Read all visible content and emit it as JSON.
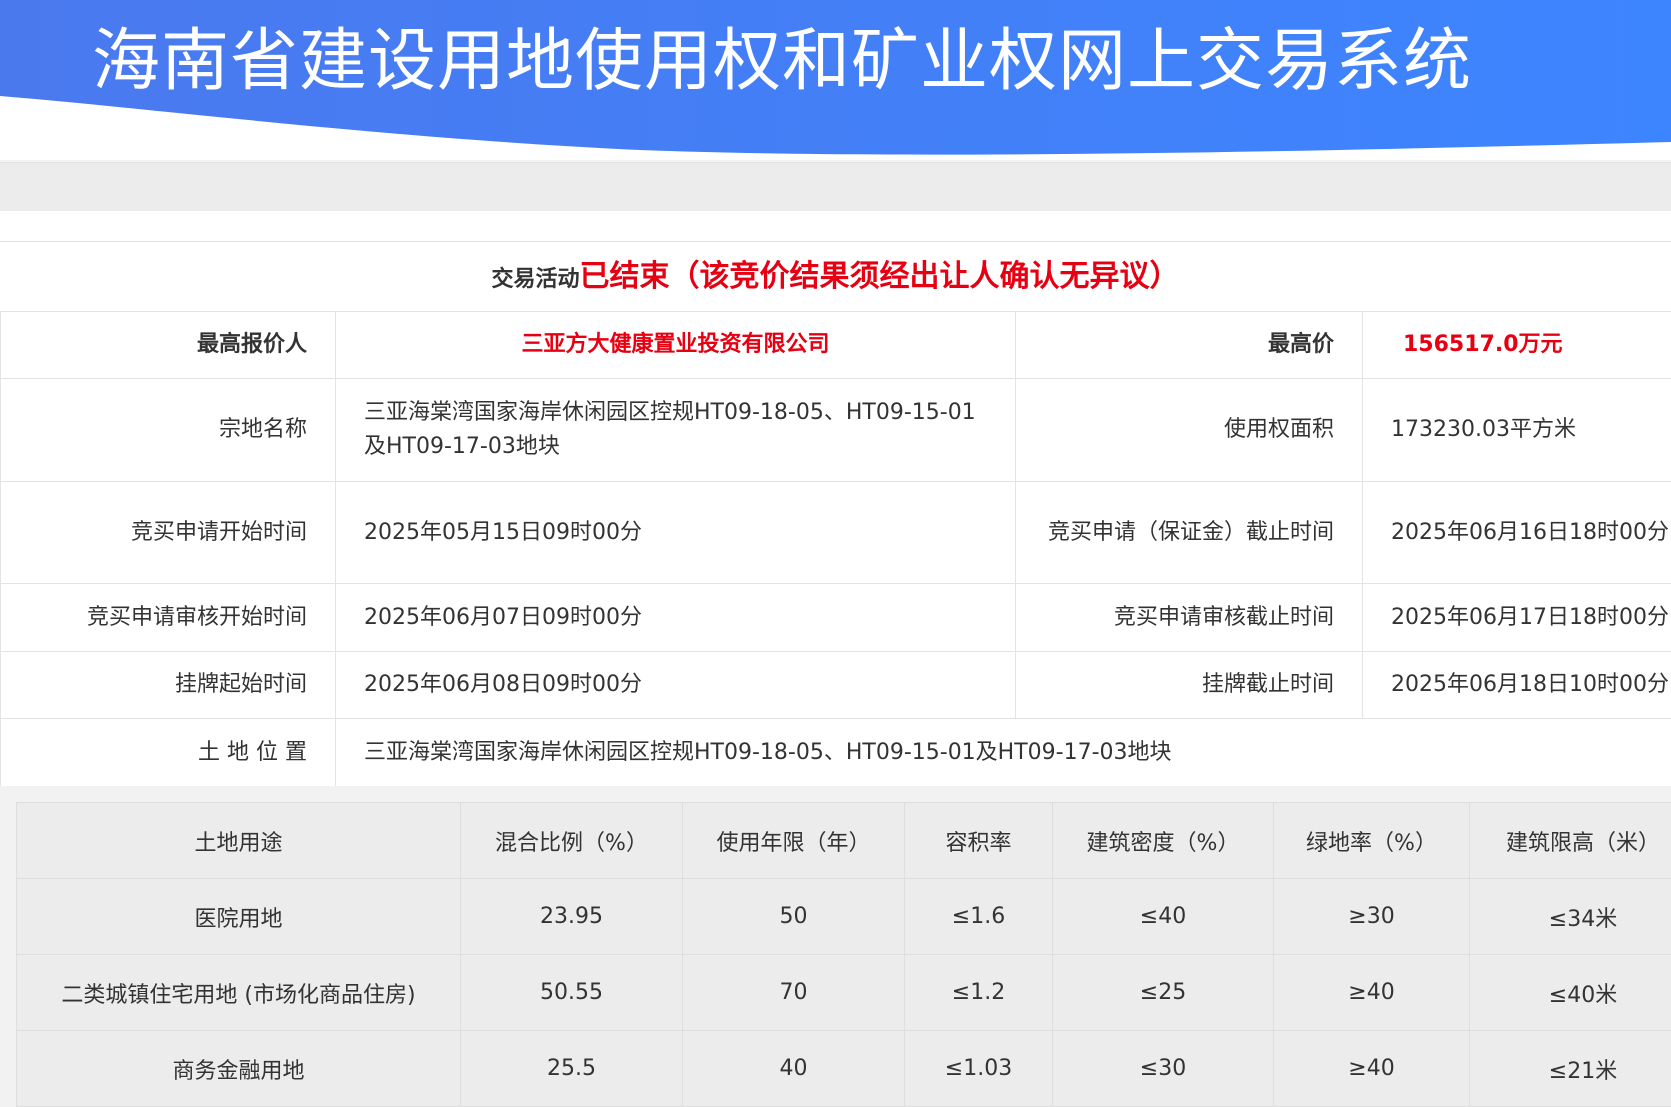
{
  "header": {
    "title": "海南省建设用地使用权和矿业权网上交易系统",
    "gradient_start": "#4a7df0",
    "gradient_end": "#3f83ff"
  },
  "status": {
    "prefix": "交易活动",
    "value": "已结束（该竞价结果须经出让人确认无异议）"
  },
  "info": {
    "top_bidder_label": "最高报价人",
    "top_bidder": "三亚方大健康置业投资有限公司",
    "top_price_label": "最高价",
    "top_price": "156517.0万元",
    "parcel_name_label": "宗地名称",
    "parcel_name": "三亚海棠湾国家海岸休闲园区控规HT09-18-05、HT09-15-01及HT09-17-03地块",
    "area_label": "使用权面积",
    "area": "173230.03平方米",
    "apply_start_label": "竞买申请开始时间",
    "apply_start": "2025年05月15日09时00分",
    "apply_deadline_label": "竞买申请（保证金）截止时间",
    "apply_deadline": "2025年06月16日18时00分",
    "review_start_label": "竞买申请审核开始时间",
    "review_start": "2025年06月07日09时00分",
    "review_end_label": "竞买申请审核截止时间",
    "review_end": "2025年06月17日18时00分",
    "listing_start_label": "挂牌起始时间",
    "listing_start": "2025年06月08日09时00分",
    "listing_end_label": "挂牌截止时间",
    "listing_end": "2025年06月18日10时00分",
    "location_label": "土 地 位 置",
    "location": "三亚海棠湾国家海岸休闲园区控规HT09-18-05、HT09-15-01及HT09-17-03地块"
  },
  "usage": {
    "headers": [
      "土地用途",
      "混合比例（%）",
      "使用年限（年）",
      "容积率",
      "建筑密度（%）",
      "绿地率（%）",
      "建筑限高（米）"
    ],
    "rows": [
      [
        "医院用地",
        "23.95",
        "50",
        "≤1.6",
        "≤40",
        "≥30",
        "≤34米"
      ],
      [
        "二类城镇住宅用地 (市场化商品住房)",
        "50.55",
        "70",
        "≤1.2",
        "≤25",
        "≥40",
        "≤40米"
      ],
      [
        "商务金融用地",
        "25.5",
        "40",
        "≤1.03",
        "≤30",
        "≥40",
        "≤21米"
      ]
    ]
  }
}
